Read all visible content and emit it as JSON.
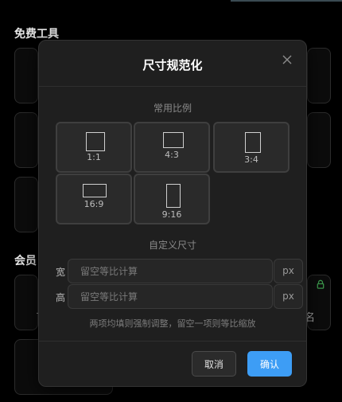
{
  "background": {
    "section_free": "免费工具",
    "section_member": "会员",
    "card_partial_text": "名"
  },
  "dialog": {
    "title": "尺寸规范化",
    "common_ratios_label": "常用比例",
    "ratios": [
      {
        "label": "1:1"
      },
      {
        "label": "4:3"
      },
      {
        "label": "3:4"
      },
      {
        "label": "16:9"
      },
      {
        "label": "9:16"
      }
    ],
    "custom_size_label": "自定义尺寸",
    "width_label": "宽",
    "height_label": "高",
    "width_placeholder": "留空等比计算",
    "height_placeholder": "留空等比计算",
    "unit": "px",
    "hint": "两项均填则强制调整，留空一项则等比缩放",
    "cancel_label": "取消",
    "confirm_label": "确认"
  },
  "colors": {
    "accent": "#3d9df5",
    "lock_icon": "#3c9a4c"
  },
  "icons": [
    "close-icon",
    "lock-icon"
  ]
}
